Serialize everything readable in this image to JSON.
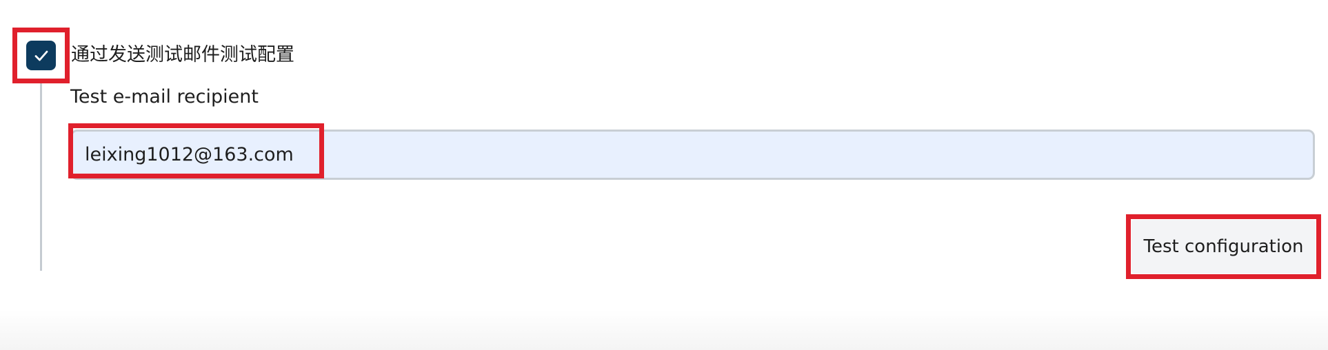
{
  "form": {
    "send_test_checkbox": {
      "checked": true,
      "label": "通过发送测试邮件测试配置"
    },
    "recipient": {
      "label": "Test e-mail recipient",
      "value": "leixing1012@163.com"
    },
    "test_button_label": "Test configuration"
  },
  "icons": {
    "checkbox_check": "check-icon"
  },
  "colors": {
    "checkbox_fill": "#0d3b5e",
    "input_background": "#e8f0fe",
    "highlight": "#e0202c",
    "guide_line": "#c5cbd1"
  }
}
